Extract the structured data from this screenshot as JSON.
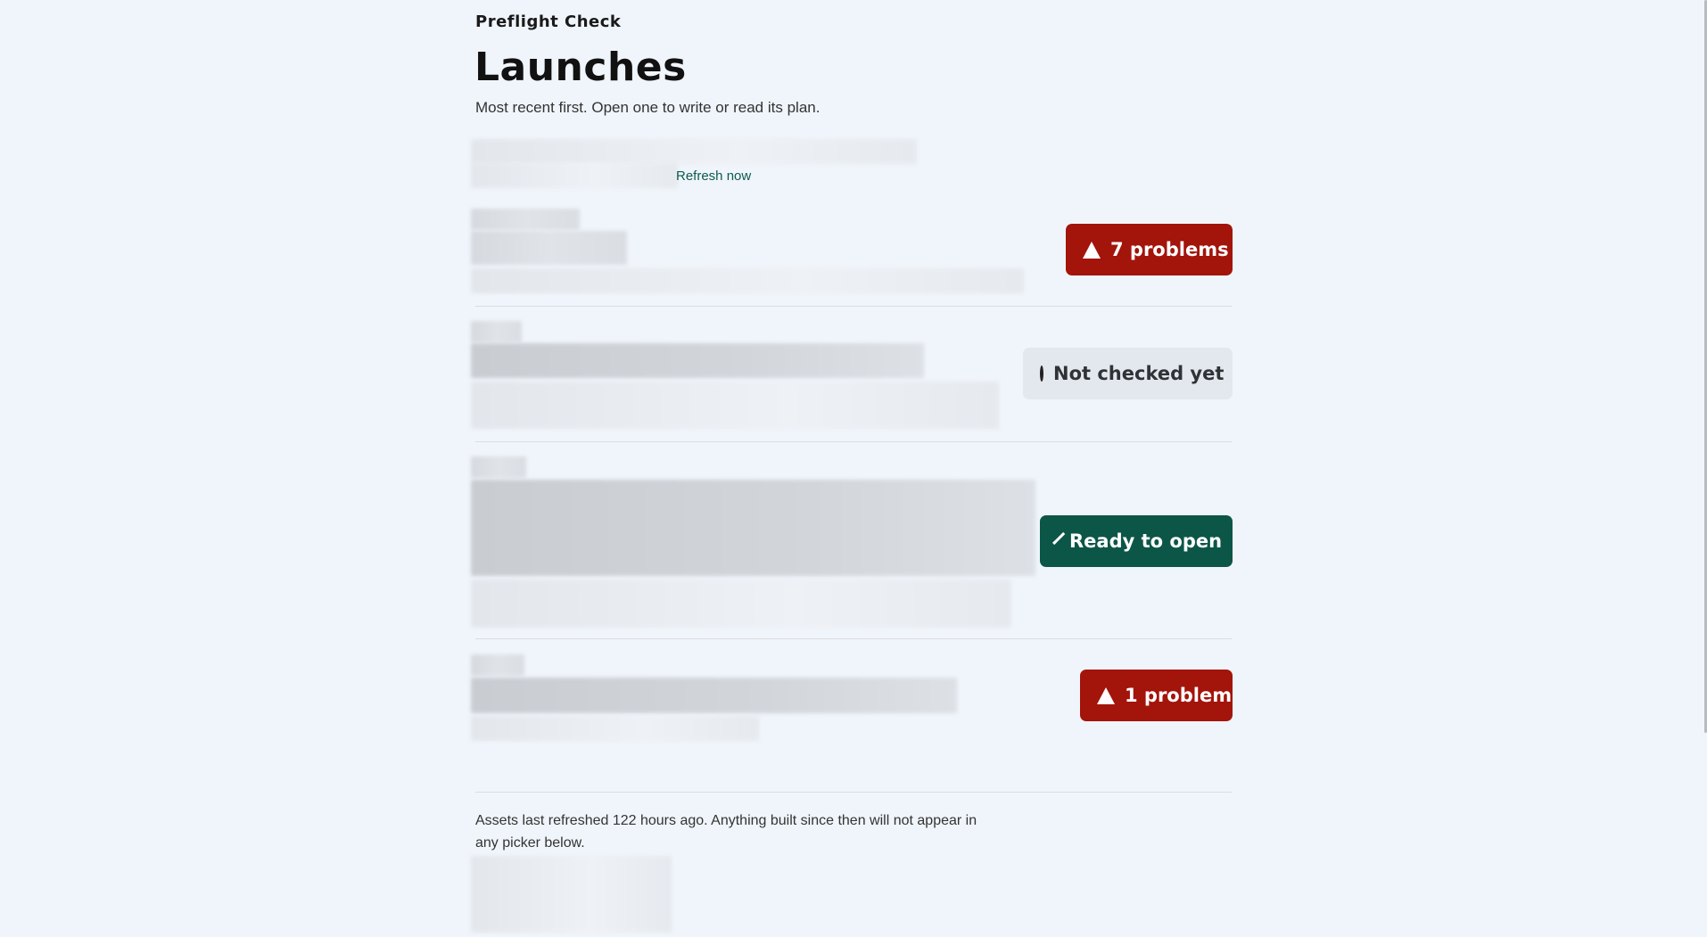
{
  "header": {
    "brand": "Preflight Check",
    "title": "Launches",
    "subtitle": "Most recent first. Open one to write or read its plan."
  },
  "toolbar": {
    "refresh_label": "Refresh now"
  },
  "launches": [
    {
      "status": "problem",
      "badge_label": "7 problems",
      "icon": "warning-triangle-icon"
    },
    {
      "status": "unchecked",
      "badge_label": "Not checked yet",
      "icon": "circle-outline-icon"
    },
    {
      "status": "ready",
      "badge_label": "Ready to open",
      "icon": "checkmark-icon"
    },
    {
      "status": "problem",
      "badge_label": "1 problem",
      "icon": "warning-triangle-icon"
    }
  ],
  "footer": {
    "note": "Assets last refreshed 122 hours ago. Anything built since then will not appear in any picker below."
  },
  "colors": {
    "background": "#f0f5fb",
    "problem": "#a3140b",
    "ready": "#0c5647",
    "unchecked": "#e3e8ee",
    "link": "#0d5a50"
  }
}
